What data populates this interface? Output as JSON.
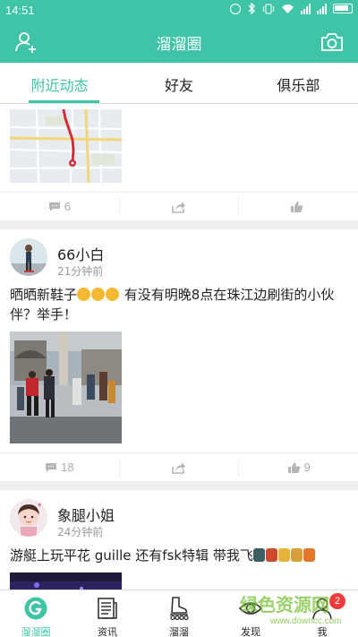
{
  "status_bar": {
    "time": "14:51",
    "icons": [
      "alarm-icon",
      "bluetooth-icon",
      "vibrate-icon",
      "wifi-icon",
      "signal-icon",
      "signal-icon",
      "battery-icon"
    ]
  },
  "header": {
    "title": "溜溜圈",
    "left_icon": "add-user-icon",
    "right_icon": "camera-icon",
    "background": "#40c4a8"
  },
  "tabs": [
    {
      "label": "附近动态",
      "active": true
    },
    {
      "label": "好友",
      "active": false
    },
    {
      "label": "俱乐部",
      "active": false
    }
  ],
  "posts": [
    {
      "image": "map-route",
      "comments": "6",
      "share_icon": "share-icon",
      "like_icon": "thumbs-up-icon",
      "likes": ""
    },
    {
      "user": "66小白",
      "time": "21分钟前",
      "text_before": "晒晒新鞋子",
      "text_after": " 有没有明晚8点在珠江边刷街的小伙伴？举手！",
      "emojis": [
        "sad-face-emoji",
        "sad-face-emoji",
        "sad-face-emoji"
      ],
      "image": "skaters-photo",
      "comments": "18",
      "likes": "9"
    },
    {
      "user": "象腿小姐",
      "time": "24分钟前",
      "text": "游艇上玩平花 guille 还有fsk特辑 带我飞"
    }
  ],
  "bottom_nav": [
    {
      "label": "溜溜圈",
      "icon": "g-logo-icon",
      "active": true
    },
    {
      "label": "资讯",
      "icon": "news-icon",
      "active": false
    },
    {
      "label": "溜溜",
      "icon": "skate-icon",
      "active": false
    },
    {
      "label": "发现",
      "icon": "eye-icon",
      "active": false
    },
    {
      "label": "我",
      "icon": "person-icon",
      "active": false,
      "badge": "2"
    }
  ],
  "watermark": {
    "line1": "绿色资源网",
    "line2": "www.downcc.com"
  },
  "colors": {
    "accent": "#40c4a8",
    "badge": "#ef3b3b"
  }
}
